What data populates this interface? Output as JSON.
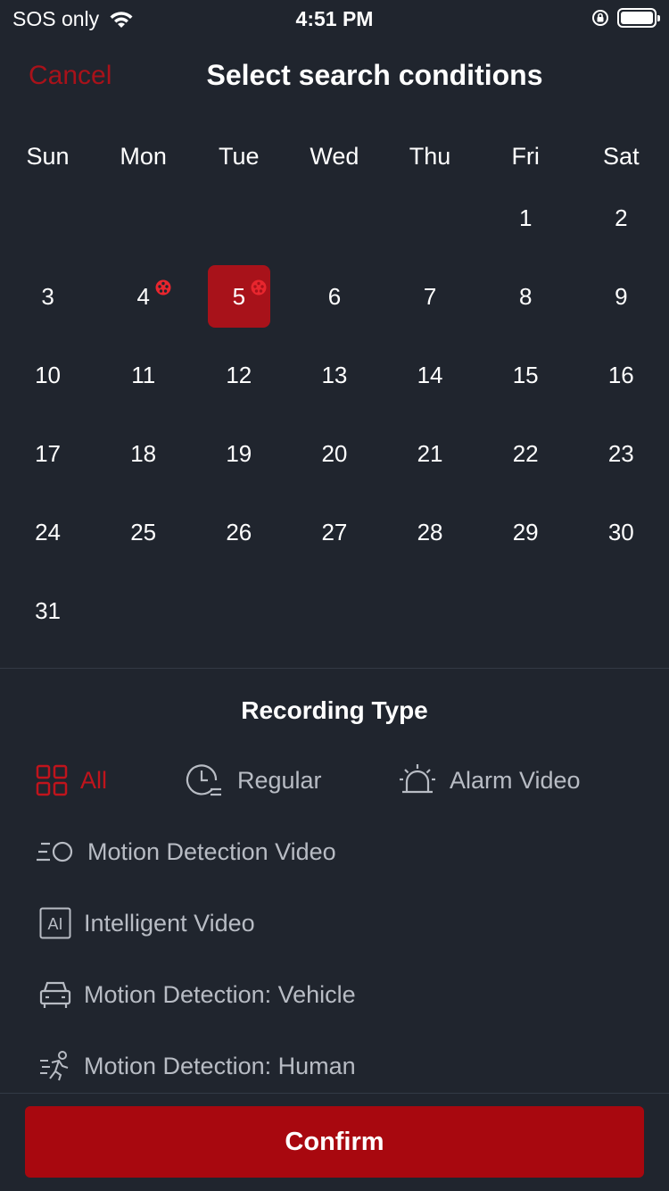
{
  "status_bar": {
    "carrier": "SOS only",
    "time": "4:51 PM"
  },
  "header": {
    "cancel_label": "Cancel",
    "title": "Select search conditions"
  },
  "calendar": {
    "weekdays": [
      "Sun",
      "Mon",
      "Tue",
      "Wed",
      "Thu",
      "Fri",
      "Sat"
    ],
    "first_weekday_index": 5,
    "days_in_month": 31,
    "selected_day": 5,
    "days_with_recordings": [
      4,
      5
    ]
  },
  "recording_type": {
    "section_title": "Recording Type",
    "options": [
      {
        "label": "All",
        "icon": "grid-icon",
        "active": true
      },
      {
        "label": "Regular",
        "icon": "clock-icon",
        "active": false
      },
      {
        "label": "Alarm Video",
        "icon": "alarm-icon",
        "active": false
      },
      {
        "label": "Motion Detection Video",
        "icon": "motion-icon",
        "active": false
      },
      {
        "label": "Intelligent Video",
        "icon": "ai-icon",
        "active": false
      },
      {
        "label": "Motion Detection: Vehicle",
        "icon": "vehicle-icon",
        "active": false
      },
      {
        "label": "Motion Detection: Human",
        "icon": "human-icon",
        "active": false
      }
    ]
  },
  "confirm_label": "Confirm",
  "colors": {
    "background": "#20252e",
    "accent": "#a8121a",
    "active_text": "#c0141c",
    "inactive_text": "#b8bcc4"
  }
}
